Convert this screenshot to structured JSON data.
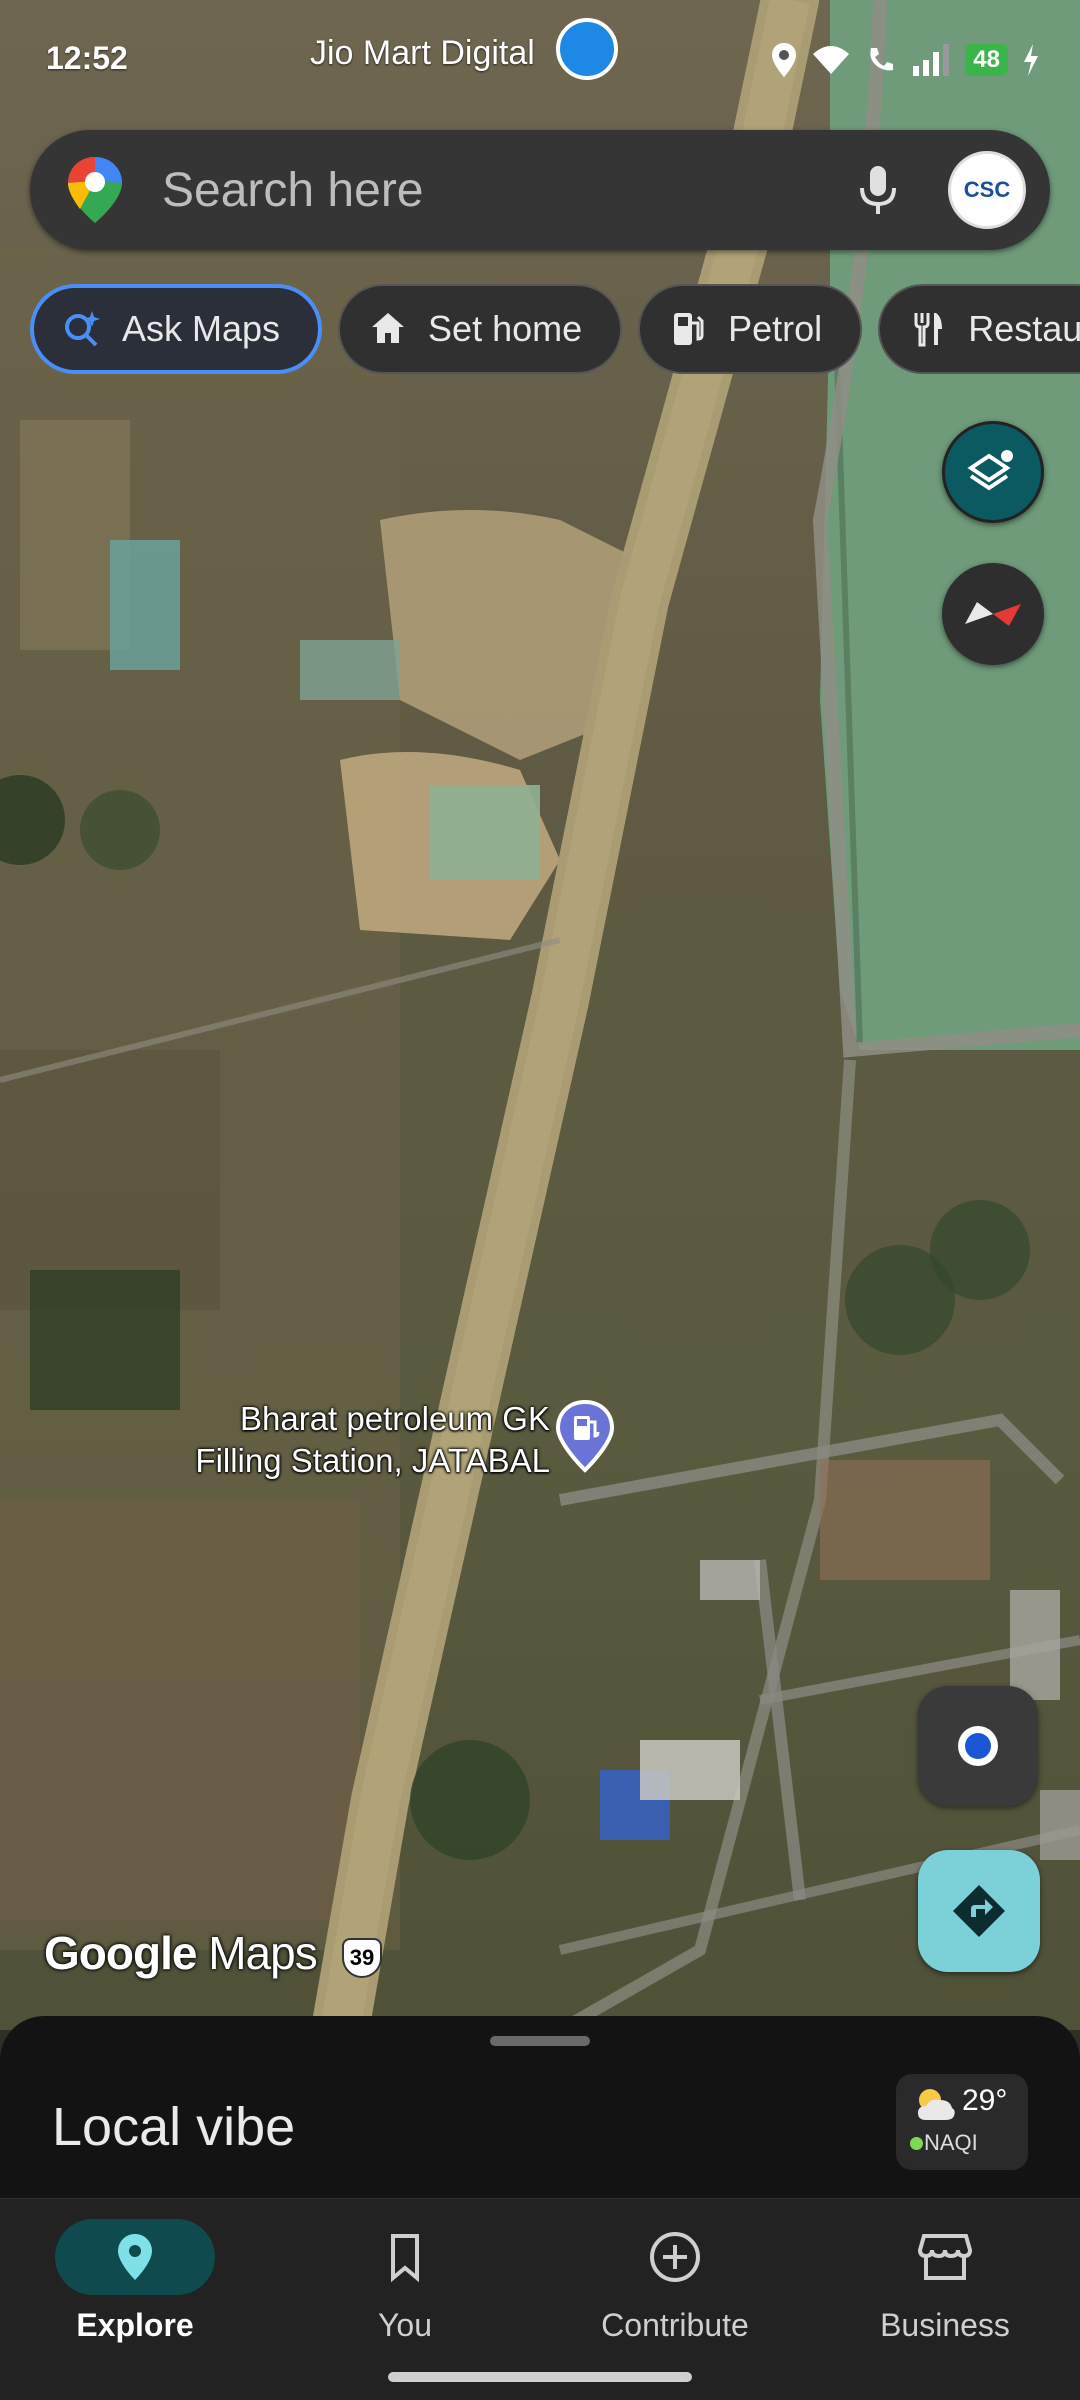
{
  "status_bar": {
    "time": "12:52",
    "notification_text": "Jio Mart Digital",
    "battery": "48"
  },
  "search": {
    "placeholder": "Search here",
    "avatar_text": "CSC"
  },
  "chips": [
    {
      "label": "Ask Maps",
      "icon": "ask-maps-icon"
    },
    {
      "label": "Set home",
      "icon": "home-icon"
    },
    {
      "label": "Petrol",
      "icon": "fuel-icon"
    },
    {
      "label": "Restau",
      "icon": "restaurant-icon"
    }
  ],
  "map": {
    "place_label_line1": "Bharat petroleum GK",
    "place_label_line2": "Filling Station, JATABAL",
    "road_shield": "39",
    "brand_google": "Google",
    "brand_maps": "Maps"
  },
  "sheet": {
    "title": "Local vibe",
    "weather_temp": "29°",
    "weather_aqi": "NAQI"
  },
  "nav": {
    "explore": "Explore",
    "you": "You",
    "contribute": "Contribute",
    "business": "Business"
  },
  "colors": {
    "accent": "#4a8ff5",
    "nav_active": "#0f4a4f",
    "directions": "#7cd0d8",
    "water": "#6f9b7a"
  }
}
